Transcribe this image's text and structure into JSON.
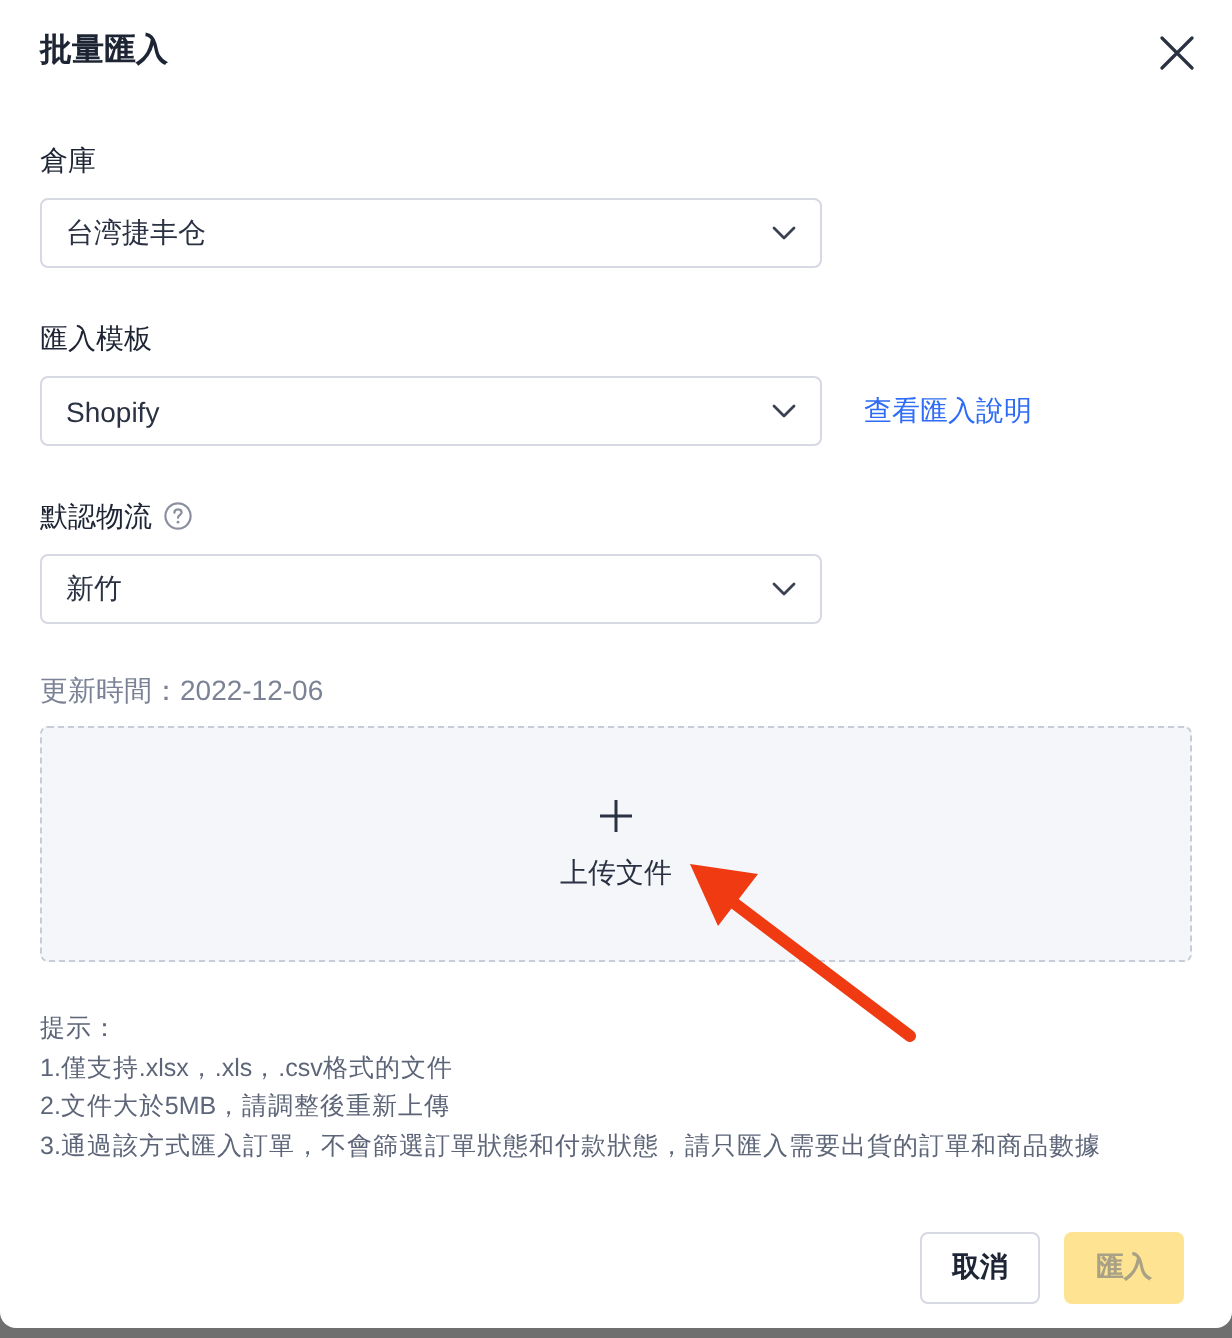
{
  "dialog": {
    "title": "批量匯入"
  },
  "fields": [
    {
      "kind": "select",
      "label": "倉庫",
      "value": "台湾捷丰仓"
    },
    {
      "kind": "select",
      "label": "匯入模板",
      "value": "Shopify",
      "link": "查看匯入說明"
    },
    {
      "kind": "select",
      "label": "默認物流",
      "value": "新竹",
      "help": true
    }
  ],
  "update_time": "更新時間：2022-12-06",
  "upload": {
    "label": "上传文件"
  },
  "tips": {
    "title": "提示：",
    "lines": [
      "1.僅支持.xlsx，.xls，.csv格式的文件",
      "2.文件大於5MB，請調整後重新上傳",
      "3.通過該方式匯入訂單，不會篩選訂單狀態和付款狀態，請只匯入需要出貨的訂單和商品數據"
    ]
  },
  "buttons": [
    {
      "label": "取消",
      "kind": "secondary",
      "disabled": false
    },
    {
      "label": "匯入",
      "kind": "primary",
      "disabled": true
    }
  ]
}
